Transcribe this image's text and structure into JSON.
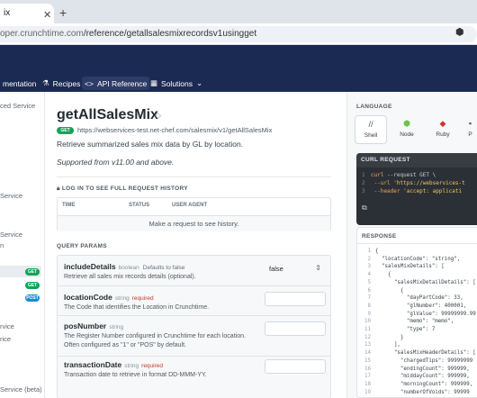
{
  "browser": {
    "tab_title": "ix",
    "url_dim": "oper.crunchtime.com",
    "url_path": "/reference/getallsalesmixrecordsv1usingget"
  },
  "nav": {
    "items": [
      {
        "label": "mentation"
      },
      {
        "label": "Recipes"
      },
      {
        "label": "API Reference"
      },
      {
        "label": "Solutions"
      }
    ]
  },
  "sidebar": {
    "items": [
      "ced Service",
      "Service",
      "Service",
      "n",
      "rvice",
      "rice",
      "Service",
      "Service (beta)"
    ],
    "badges": [
      "GET",
      "GET",
      "POST"
    ]
  },
  "main": {
    "title": "getAllSalesMix",
    "method": "GET",
    "endpoint": "https://webservices-test.net-chef.com/salesmix/v1/getAllSalesMix",
    "description": "Retrieve summarized sales mix data by GL by location.",
    "supported": "Supported from v11.00 and above.",
    "log_header": "LOG IN TO SEE FULL REQUEST HISTORY",
    "log_columns": [
      "TIME",
      "STATUS",
      "USER AGENT"
    ],
    "log_empty": "Make a request to see history.",
    "query_params_header": "QUERY PARAMS",
    "params": [
      {
        "name": "includeDetails",
        "type": "boolean",
        "default": "Defaults to false",
        "required": "",
        "desc": "Retrieve all sales mix records details (optional).",
        "value": "false"
      },
      {
        "name": "locationCode",
        "type": "string",
        "default": "",
        "required": "required",
        "desc": "The Code that identifies the Location in Crunchtime.",
        "value": ""
      },
      {
        "name": "posNumber",
        "type": "string",
        "default": "",
        "required": "",
        "desc": "The Register Number configured in Crunchtime for each location. Often configured as \"1\" or \"POS\" by default.",
        "value": ""
      },
      {
        "name": "transactionDate",
        "type": "string",
        "default": "",
        "required": "required",
        "desc": "Transaction date to retrieve in format DD-MMM-YY.",
        "value": ""
      }
    ]
  },
  "right": {
    "language_header": "LANGUAGE",
    "languages": [
      "Shell",
      "Node",
      "Ruby",
      "P"
    ],
    "curl_header": "CURL REQUEST",
    "curl_lines": [
      {
        "n": "1",
        "a": "curl ",
        "b": "--request GET \\"
      },
      {
        "n": "2",
        "a": "     --url ",
        "b": "'https://webservices-t"
      },
      {
        "n": "3",
        "a": "     --header ",
        "b": "'accept: applicati"
      }
    ],
    "response_header": "RESPONSE",
    "response_lines": [
      {
        "n": "1",
        "t": "{"
      },
      {
        "n": "2",
        "t": "  \"locationCode\": \"string\","
      },
      {
        "n": "3",
        "t": "  \"salesMixDetails\": ["
      },
      {
        "n": "4",
        "t": "    {"
      },
      {
        "n": "5",
        "t": "      \"salesMixDetailDetails\": ["
      },
      {
        "n": "6",
        "t": "        {"
      },
      {
        "n": "7",
        "t": "          \"dayPartCode\": 33,"
      },
      {
        "n": "8",
        "t": "          \"glNumber\": 400001,"
      },
      {
        "n": "9",
        "t": "          \"glValue\": 99999999.99"
      },
      {
        "n": "10",
        "t": "          \"memo\": \"memo\","
      },
      {
        "n": "11",
        "t": "          \"type\": 7"
      },
      {
        "n": "12",
        "t": "        }"
      },
      {
        "n": "13",
        "t": "      ],"
      },
      {
        "n": "14",
        "t": "      \"salesMixHeaderDetails\": ["
      },
      {
        "n": "15",
        "t": "        \"chargedTips\": 99999999"
      },
      {
        "n": "16",
        "t": "        \"endingCount\": 999999,"
      },
      {
        "n": "17",
        "t": "        \"middayCount\": 999999,"
      },
      {
        "n": "18",
        "t": "        \"morningCount\": 999999,"
      },
      {
        "n": "19",
        "t": "        \"numberOfVoids\": 99999"
      }
    ]
  },
  "colors": {
    "nav_bg": "#1b2a52",
    "get": "#15a35a",
    "post": "#1b8ad6"
  }
}
